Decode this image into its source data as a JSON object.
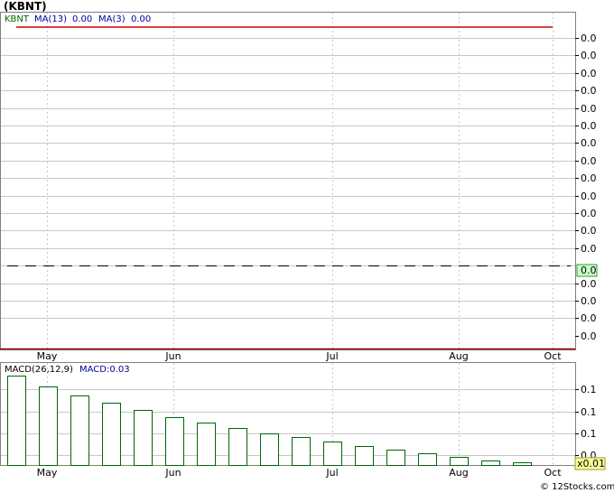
{
  "chart_data": [
    {
      "type": "line",
      "title": "(KBNT)",
      "legend": {
        "symbol": "KBNT",
        "ma13_label": "MA(13)",
        "ma13_value": "0.00",
        "ma3_label": "MA(3)",
        "ma3_value": "0.00"
      },
      "x_tick_labels": [
        "May",
        "Jun",
        "Jul",
        "Aug",
        "Oct"
      ],
      "y_tick_labels": [
        "0.0",
        "0.0",
        "0.0",
        "0.0",
        "0.0",
        "0.0",
        "0.0",
        "0.0",
        "0.0",
        "0.0",
        "0.0",
        "0.0",
        "0.0",
        "0.0",
        "0.0",
        "0.0",
        "0.0",
        "0.0"
      ],
      "current_price_label": "0.0",
      "series": [
        {
          "name": "MA(13)",
          "values": [
            0.0,
            0.0
          ]
        },
        {
          "name": "MA(3)",
          "values": [
            0.0,
            0.0
          ]
        }
      ],
      "price_level": 0.0,
      "colors": {
        "ma_line": "#cc0000",
        "price_line": "#000000",
        "label_box": "#ccffcc",
        "axis_line": "#990000"
      },
      "grid": true
    },
    {
      "type": "bar",
      "title": "MACD(26,12,9)",
      "value_label": "MACD:0.03",
      "x_tick_labels": [
        "May",
        "Jun",
        "Jul",
        "Aug",
        "Oct"
      ],
      "y_tick_labels": [
        "0.1",
        "0.1",
        "0.1",
        "0.0",
        "0.0"
      ],
      "scale_label": "x0.01",
      "values": [
        0.99,
        0.87,
        0.77,
        0.69,
        0.61,
        0.53,
        0.47,
        0.41,
        0.35,
        0.31,
        0.26,
        0.21,
        0.17,
        0.13,
        0.09,
        0.05,
        0.03
      ],
      "ylim": [
        0,
        1
      ],
      "colors": {
        "bar_stroke": "#006600",
        "bar_fill": "#ffffff",
        "scale_box": "#ffff99"
      },
      "grid": true
    }
  ],
  "watermark": "© 12Stocks.com"
}
